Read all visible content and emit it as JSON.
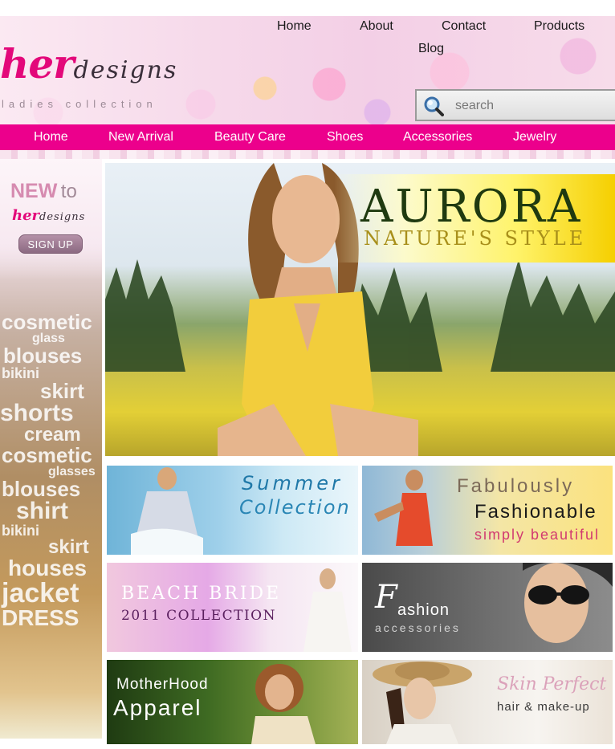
{
  "header": {
    "logo": {
      "her": "her",
      "designs": "designs",
      "tagline": "ladies collection"
    },
    "top_nav": [
      "Home",
      "About",
      "Contact",
      "Products",
      "Blog"
    ],
    "search": {
      "placeholder": "search"
    }
  },
  "menu": [
    "Home",
    "New Arrival",
    "Beauty Care",
    "Shoes",
    "Accessories",
    "Jewelry"
  ],
  "sidebar": {
    "new_word": "NEW",
    "to_word": "to",
    "mini_logo": {
      "her": "her",
      "designs": "designs"
    },
    "signup_label": "SIGN UP",
    "word_cloud": [
      "cosmetic",
      "glass",
      "blouses",
      "bikini",
      "skirt",
      "shorts",
      "cream",
      "cosmetic",
      "glasses",
      "blouses",
      "shirt",
      "bikini",
      "skirt",
      "houses",
      "jacket",
      "DRESS"
    ]
  },
  "hero": {
    "title": "AURORA",
    "subtitle": "NATURE'S STYLE"
  },
  "tiles": {
    "summer": {
      "line1": "Summer",
      "line2": "Collection"
    },
    "fabulous": {
      "line1": "Fabulously",
      "line2": "Fashionable",
      "line3": "simply beautiful"
    },
    "bride": {
      "line1": "BEACH BRIDE",
      "line2": "2011 COLLECTION"
    },
    "fashion": {
      "big_f": "F",
      "line1": "ashion",
      "line2": "accessories"
    },
    "mother": {
      "line1": "MotherHood",
      "line2": "Apparel"
    },
    "skin": {
      "line1": "Skin Perfect",
      "line2": "hair & make-up"
    }
  },
  "colors": {
    "brand_pink": "#ec008c",
    "logo_pink": "#e3087a"
  }
}
